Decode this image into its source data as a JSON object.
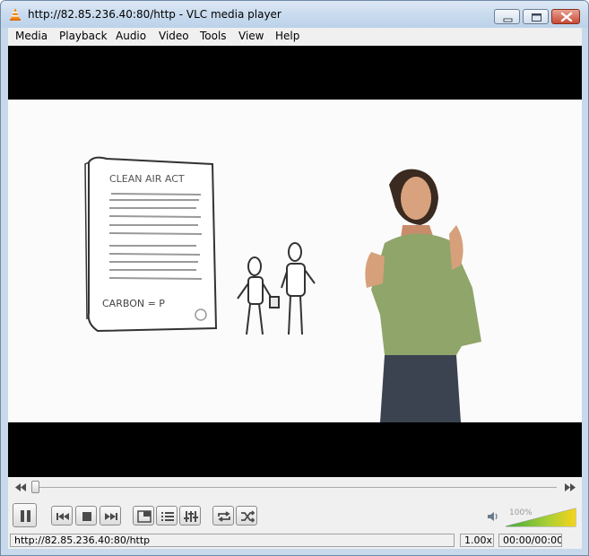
{
  "window": {
    "title": "http://82.85.236.40:80/http - VLC media player"
  },
  "menu": {
    "items": [
      "Media",
      "Playback",
      "Audio",
      "Video",
      "Tools",
      "View",
      "Help"
    ]
  },
  "video": {
    "document_heading": "CLEAN AIR ACT",
    "document_footer": "CARBON = P"
  },
  "controls": {
    "seek_progress_percent": 0,
    "volume_percent_label": "100%",
    "volume_level": 1.0
  },
  "status": {
    "url": "http://82.85.236.40:80/http",
    "speed": "1.00x",
    "time": "00:00/00:00"
  },
  "colors": {
    "title_gradient_top": "#dfe9f5",
    "close_button": "#c74a35",
    "volume_gradient_low": "#3fa83a",
    "volume_gradient_high": "#f5d31a"
  },
  "icons": {
    "app": "vlc-cone-icon",
    "minimize": "minimize-icon",
    "maximize": "maximize-icon",
    "close": "close-icon",
    "seek_back": "rewind-icon",
    "seek_forward": "fast-forward-icon",
    "play_pause": "pause-icon",
    "previous": "previous-icon",
    "stop": "stop-icon",
    "next": "next-icon",
    "fullscreen": "fullscreen-icon",
    "playlist": "playlist-icon",
    "extended": "equalizer-icon",
    "loop": "loop-icon",
    "random": "shuffle-icon",
    "speaker": "speaker-icon"
  }
}
